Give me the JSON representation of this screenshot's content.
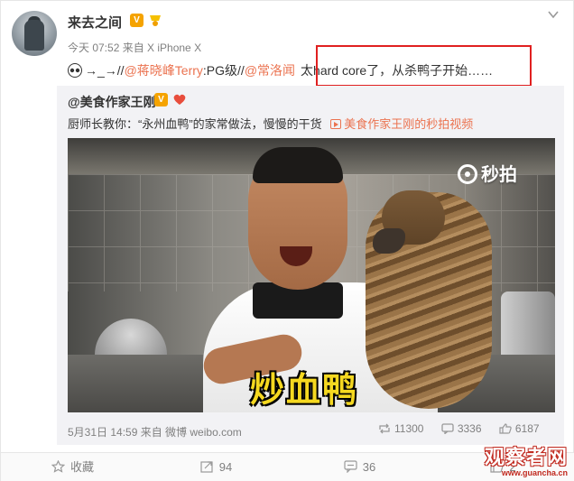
{
  "post": {
    "username": "来去之间",
    "vip_badge": "V",
    "meta": "今天 07:52 来自 X iPhone X",
    "repost_prefix": "→_→//",
    "mention_1": "@蒋晓峰Terry",
    "repost_middle_1": ":PG级//",
    "mention_2": "@常洛闻",
    "repost_highlight": "太hard core了，从杀鸭子开始……"
  },
  "original": {
    "username": "@美食作家王刚",
    "vip_badge": "V",
    "text": "厨师长教你：“永州血鸭”的家常做法，慢慢的干货",
    "video_link": "美食作家王刚的秒拍视频",
    "meta": "5月31日 14:59 来自 微博 weibo.com",
    "stats": {
      "reposts": "11300",
      "comments": "3336",
      "likes": "6187"
    },
    "video": {
      "watermark": "秒拍",
      "subtitle": "炒血鸭"
    }
  },
  "actions": {
    "favorite": "收藏",
    "forward": "94",
    "comment": "36",
    "like": "2"
  },
  "site_watermark": {
    "cn": "观察者网",
    "en": "www.guancha.cn"
  },
  "colors": {
    "accent": "#eb7350",
    "highlight_border": "#e02020",
    "vip": "#f5a300",
    "subtitle": "#f5d820"
  },
  "icons": [
    "chevron-down-icon",
    "vip-badge-icon",
    "member-badge-icon",
    "video-play-icon",
    "repost-icon",
    "comment-icon",
    "like-icon",
    "favorite-icon"
  ]
}
